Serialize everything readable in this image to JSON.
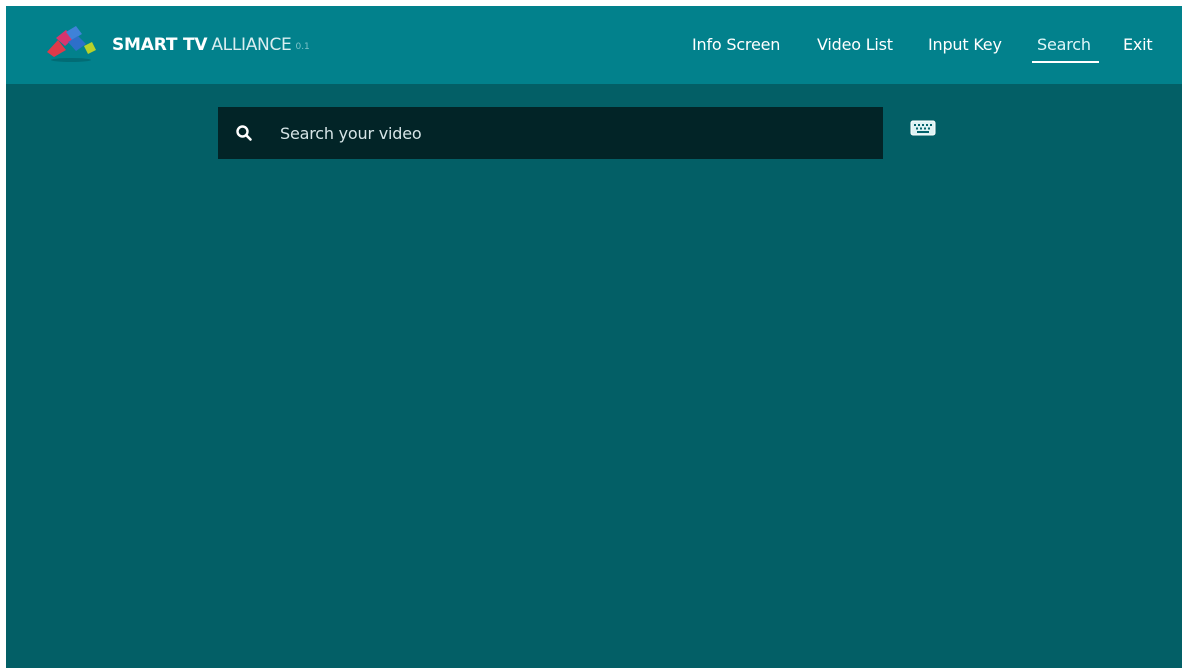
{
  "header": {
    "brand_bold": "SMART TV",
    "brand_light": "ALLIANCE",
    "version": "0.1",
    "logo_icon": "smart-tv-alliance-logo-icon"
  },
  "nav": {
    "items": [
      {
        "label": "Info Screen",
        "active": false
      },
      {
        "label": "Video List",
        "active": false
      },
      {
        "label": "Input Key",
        "active": false
      },
      {
        "label": "Search",
        "active": true
      },
      {
        "label": "Exit",
        "active": false
      }
    ]
  },
  "search": {
    "placeholder": "Search your video",
    "value": "",
    "icon": "search-icon",
    "keyboard_icon": "keyboard-icon"
  },
  "colors": {
    "header_bg": "#02818c",
    "body_bg": "#035f66",
    "search_bg": "#022427",
    "text": "#ffffff"
  }
}
